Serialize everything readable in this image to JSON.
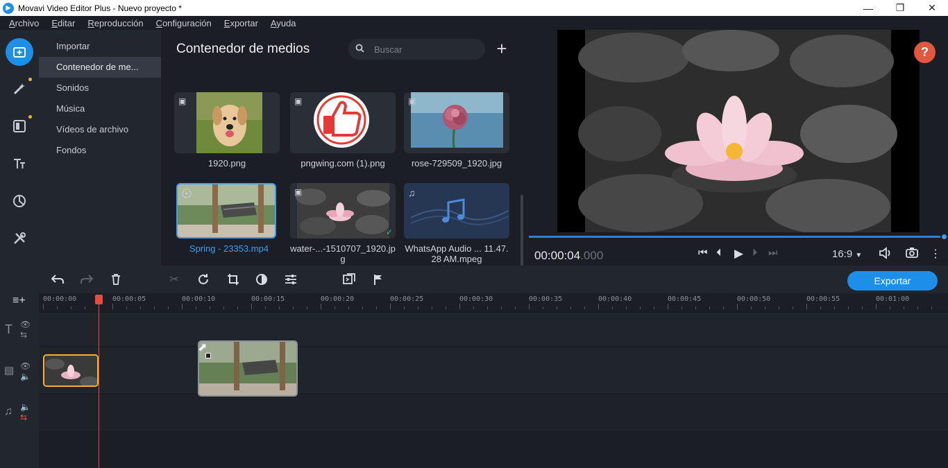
{
  "window": {
    "title": "Movavi Video Editor Plus - Nuevo proyecto *",
    "app_icon": "movavi-logo-icon",
    "controls": [
      "minimize-icon",
      "restore-icon",
      "close-icon"
    ]
  },
  "menu": [
    "Archivo",
    "Editar",
    "Reproducción",
    "Configuración",
    "Exportar",
    "Ayuda"
  ],
  "sidebar_tools": [
    "import-icon",
    "magic-wand-icon",
    "transitions-icon",
    "titles-icon",
    "stickers-icon",
    "tools-icon"
  ],
  "categories": [
    "Importar",
    "Contenedor de me...",
    "Sonidos",
    "Música",
    "Vídeos de archivo",
    "Fondos"
  ],
  "media": {
    "title": "Contenedor de medios",
    "search_placeholder": "Buscar",
    "items": [
      {
        "label": "1920.png",
        "type": "image",
        "icon": "image-icon"
      },
      {
        "label": "pngwing.com (1).png",
        "type": "image",
        "icon": "image-icon"
      },
      {
        "label": "rose-729509_1920.jpg",
        "type": "image",
        "icon": "image-icon"
      },
      {
        "label": "Spring - 23353.mp4",
        "type": "video",
        "icon": "video-icon",
        "selected": true
      },
      {
        "label": "water-...-1510707_1920.jpg",
        "type": "image",
        "icon": "image-icon",
        "added": true
      },
      {
        "label": "WhatsApp Audio ... 11.47.28 AM.mpeg",
        "type": "audio",
        "icon": "music-note-icon"
      }
    ]
  },
  "preview": {
    "timecode_main": "00:00:04",
    "timecode_ms": ".000",
    "aspect_ratio": "16:9",
    "position_fraction": 1.0
  },
  "toolbar": {
    "export_label": "Exportar",
    "tools": [
      "undo-icon",
      "redo-icon",
      "delete-icon",
      "cut-icon",
      "rotate-icon",
      "crop-icon",
      "color-adjust-icon",
      "settings-sliders-icon",
      "insert-icon",
      "marker-flag-icon"
    ]
  },
  "timeline": {
    "ruler_labels": [
      "00:00:00",
      "00:00:05",
      "00:00:10",
      "00:00:15",
      "00:00:20",
      "00:00:25",
      "00:00:30",
      "00:00:35",
      "00:00:40",
      "00:00:45",
      "00:00:50",
      "00:00:55",
      "00:01:00"
    ],
    "playhead_seconds": 4
  },
  "colors": {
    "accent": "#1e8fe8",
    "playhead": "#e74c3c",
    "help": "#e2583e",
    "selected_clip_border": "#f1b233"
  }
}
